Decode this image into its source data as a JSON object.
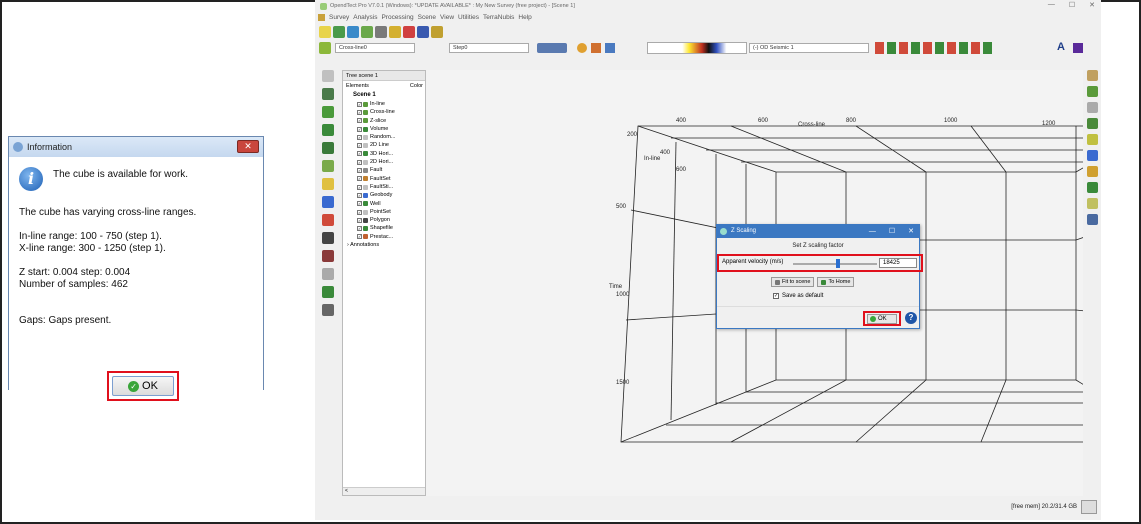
{
  "info_dialog": {
    "title": "Information",
    "close_label": "✕",
    "icon": "info-icon",
    "lines": [
      "The cube is available for work.",
      "",
      "The cube has varying cross-line ranges.",
      "",
      "In-line range: 100 - 750 (step 1).",
      "X-line range: 300 - 1250 (step 1).",
      "",
      "Z start: 0.004 step: 0.004",
      "Number of samples: 462",
      "",
      "",
      "Gaps:  Gaps present."
    ],
    "ok_label": "OK"
  },
  "app": {
    "title": "OpendTect Pro V7.0.1 (Windows): *UPDATE AVAILABLE* : My New Survey (free project) - [Scene 1]",
    "window_controls": [
      "—",
      "☐",
      "✕"
    ],
    "menu": [
      "Survey",
      "Analysis",
      "Processing",
      "Scene",
      "View",
      "Utilities",
      "TerraNubis",
      "Help"
    ],
    "toolbar2": {
      "crossline_label": "Cross-line",
      "crossline_value": "0",
      "step_label": "Step",
      "step_value": "0",
      "seismic_label": "(-) OD Seismic 1",
      "letter_a": "A"
    },
    "tree": {
      "header": "Tree scene 1",
      "col_elements": "Elements",
      "col_color": "Color",
      "root": "Scene 1",
      "items": [
        {
          "label": "In-line",
          "color": "#5a9a3a"
        },
        {
          "label": "Cross-line",
          "color": "#5a9a3a"
        },
        {
          "label": "Z-slice",
          "color": "#5a9a3a"
        },
        {
          "label": "Volume",
          "color": "#3a8a3a"
        },
        {
          "label": "Random...",
          "color": "#c0c0c0"
        },
        {
          "label": "2D Line",
          "color": "#c0c0c0"
        },
        {
          "label": "3D Hori...",
          "color": "#3a8a3a"
        },
        {
          "label": "2D Hori...",
          "color": "#c0c0c0"
        },
        {
          "label": "Fault",
          "color": "#888888"
        },
        {
          "label": "FaultSet",
          "color": "#c08030"
        },
        {
          "label": "FaultSti...",
          "color": "#c0c0c0"
        },
        {
          "label": "Geobody",
          "color": "#3a6ad0"
        },
        {
          "label": "Well",
          "color": "#3a8a3a"
        },
        {
          "label": "PointSet",
          "color": "#c0c0c0"
        },
        {
          "label": "Polygon",
          "color": "#444444"
        },
        {
          "label": "Shapefile",
          "color": "#3a8a3a"
        },
        {
          "label": "Prestac...",
          "color": "#c06030"
        }
      ],
      "annotations": "Annotations",
      "scroll_left": "<"
    },
    "viewport_labels": {
      "cross_line": "Cross-line",
      "in_line": "In-line",
      "time": "Time",
      "x_ticks": [
        "400",
        "600",
        "800",
        "1000",
        "1200"
      ],
      "in_ticks": [
        "200",
        "400",
        "600"
      ],
      "z_ticks": [
        "500",
        "1000",
        "1500"
      ]
    },
    "status": "[free mem] 20.2/31.4 GB"
  },
  "z_scaling": {
    "title": "Z Scaling",
    "controls": [
      "—",
      "☐",
      "✕"
    ],
    "heading": "Set Z scaling factor",
    "label": "Apparent velocity (m/s)",
    "value": "18425",
    "slider_fraction": 0.53,
    "fit_label": "Fit to scene",
    "home_label": "To Home",
    "save_label": "Save as default",
    "save_checked": true,
    "ok_label": "OK",
    "help": "?"
  },
  "colors": {
    "highlight": "#e0101c",
    "title_blue": "#3b78c2",
    "ok_green": "#3aa53a"
  }
}
